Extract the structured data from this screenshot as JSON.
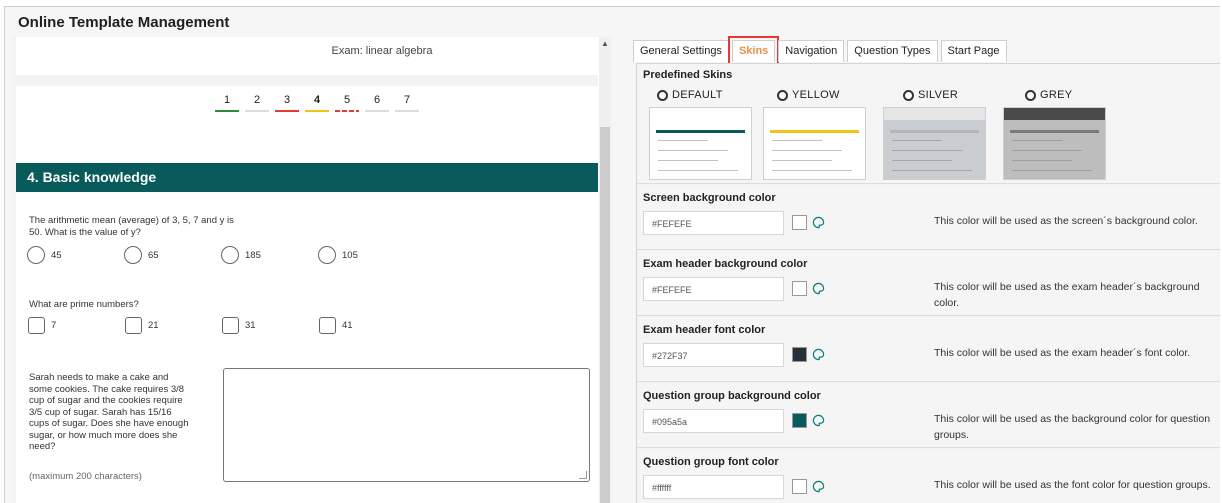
{
  "app": {
    "title": "Online Template Management"
  },
  "preview": {
    "exam_label": "Exam: linear algebra",
    "pages": [
      {
        "label": "1",
        "status_color": "#2e8b3a"
      },
      {
        "label": "2",
        "status_color": "#dddddd"
      },
      {
        "label": "3",
        "status_color": "#e53935"
      },
      {
        "label": "4",
        "status_color": "#f0c419"
      },
      {
        "label": "5",
        "status_color": "#e53935"
      },
      {
        "label": "6",
        "status_color": "#dddddd"
      },
      {
        "label": "7",
        "status_color": "#dddddd"
      }
    ],
    "group_title": "4. Basic knowledge",
    "q1": {
      "text": "The arithmetic mean (average) of 3, 5, 7 and y is 50. What is the value of y?",
      "options": [
        "45",
        "65",
        "185",
        "105"
      ]
    },
    "q2": {
      "text": "What are prime numbers?",
      "options": [
        "7",
        "21",
        "31",
        "41"
      ]
    },
    "q3": {
      "text": "Sarah needs to make a cake and some cookies. The cake requires 3/8 cup of sugar and the cookies require 3/5 cup of sugar. Sarah has 15/16 cups of sugar. Does she have enough sugar, or how much more does she need?",
      "max_chars": "(maximum 200 characters)"
    }
  },
  "tabs": [
    {
      "label": "General Settings",
      "active": false
    },
    {
      "label": "Skins",
      "active": true
    },
    {
      "label": "Navigation",
      "active": false
    },
    {
      "label": "Question Types",
      "active": false
    },
    {
      "label": "Start Page",
      "active": false
    }
  ],
  "skins": {
    "title": "Predefined Skins",
    "options": [
      {
        "label": "DEFAULT",
        "header": "#ffffff",
        "band": "#095a5a",
        "bg": "#ffffff"
      },
      {
        "label": "YELLOW",
        "header": "#ffffff",
        "band": "#f0c419",
        "bg": "#ffffff"
      },
      {
        "label": "SILVER",
        "header": "#e6e6e6",
        "band": "#b5b5b5",
        "bg": "#c9ccd1"
      },
      {
        "label": "GREY",
        "header": "#4a4a4a",
        "band": "#7a7a7a",
        "bg": "#bdbdbd"
      }
    ]
  },
  "colors": [
    {
      "title": "Screen background color",
      "value": "#FEFEFE",
      "swatch": "#ffffff",
      "desc": "This color will be used as the screen´s background color."
    },
    {
      "title": "Exam header background color",
      "value": "#FEFEFE",
      "swatch": "#ffffff",
      "desc": "This color will be used as the exam header´s background color."
    },
    {
      "title": "Exam header font color",
      "value": "#272F37",
      "swatch": "#272f37",
      "desc": "This color will be used as the exam header´s font color."
    },
    {
      "title": "Question group background color",
      "value": "#095a5a",
      "swatch": "#095a5a",
      "desc": "This color will be used as the background color for question groups."
    },
    {
      "title": "Question group font color",
      "value": "#ffffff",
      "swatch": "#ffffff",
      "desc": "This color will be used as the font color for question groups."
    }
  ]
}
